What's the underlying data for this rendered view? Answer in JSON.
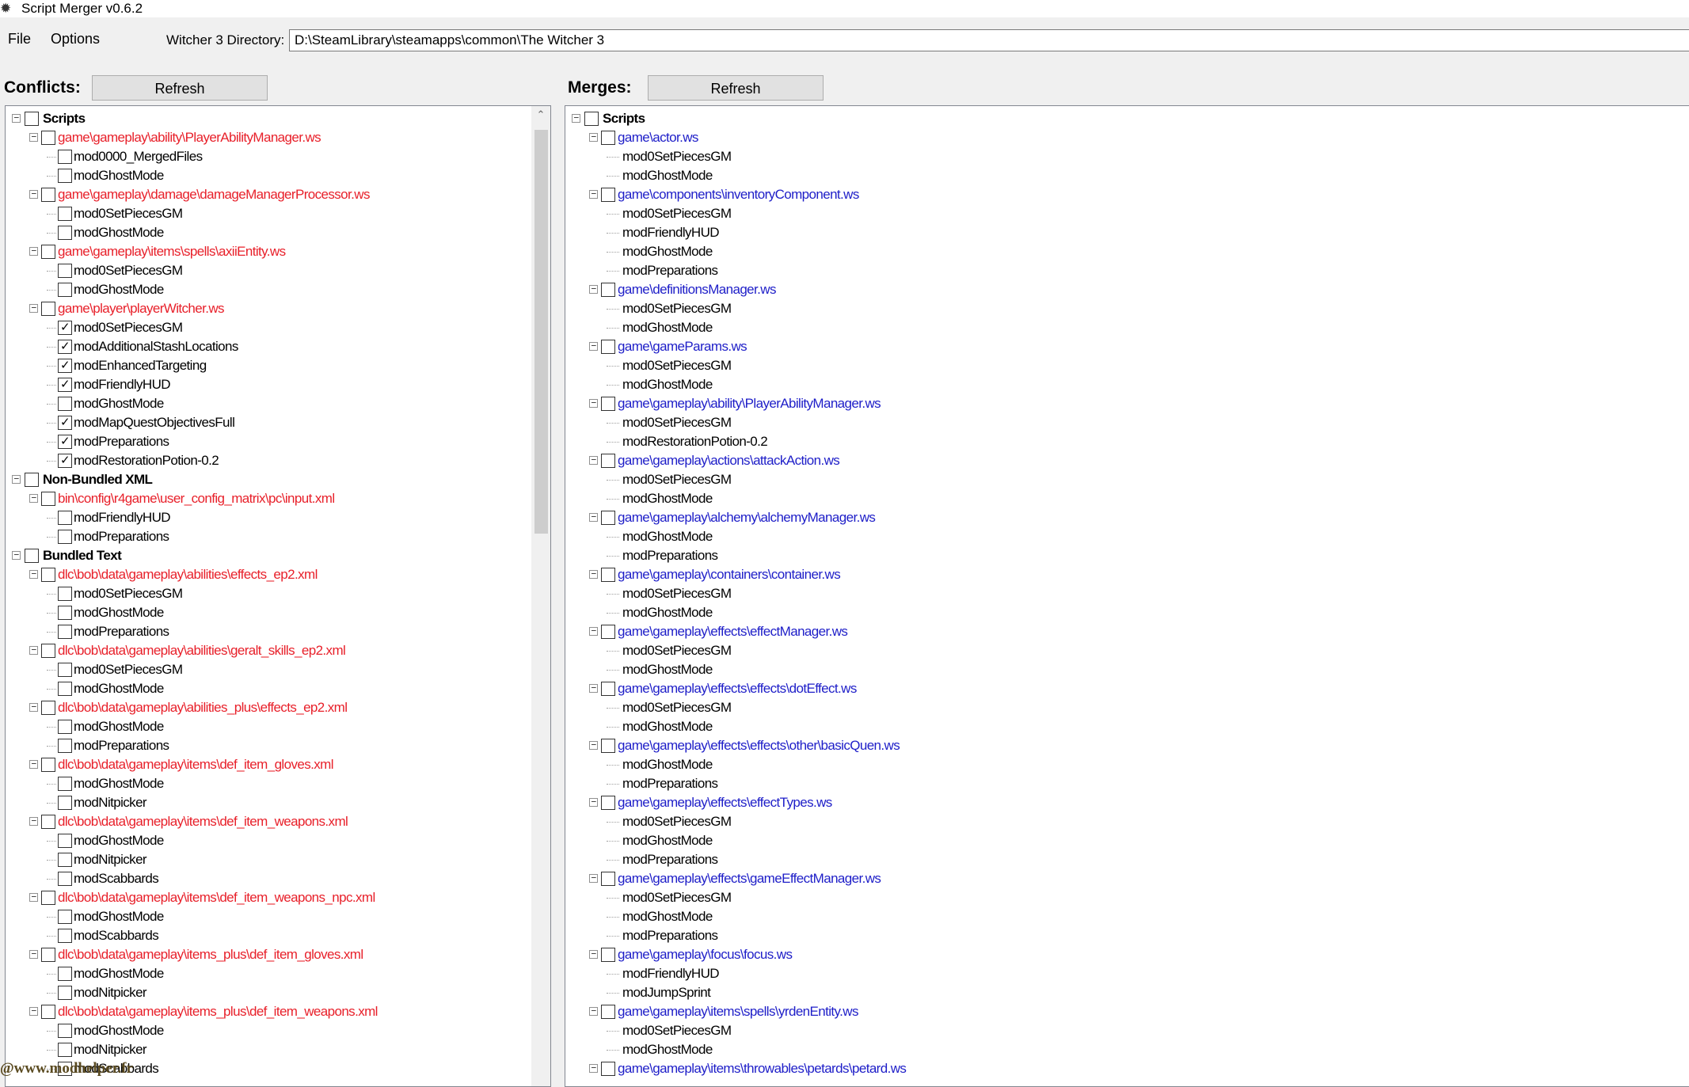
{
  "window": {
    "title": "Script Merger v0.6.2",
    "icon": "witcher-wolf-icon"
  },
  "menu": {
    "file": "File",
    "options": "Options"
  },
  "directory": {
    "label": "Witcher 3 Directory:",
    "value": "D:\\SteamLibrary\\steamapps\\common\\The Witcher 3"
  },
  "conflicts": {
    "label": "Conflicts:",
    "refresh": "Refresh",
    "rows": [
      {
        "level": 0,
        "text": "Scripts",
        "checked": false
      },
      {
        "level": 1,
        "text": "game\\gameplay\\ability\\PlayerAbilityManager.ws",
        "checked": false
      },
      {
        "level": 2,
        "text": "mod0000_MergedFiles",
        "checked": false
      },
      {
        "level": 2,
        "text": "modGhostMode",
        "checked": false
      },
      {
        "level": 1,
        "text": "game\\gameplay\\damage\\damageManagerProcessor.ws",
        "checked": false
      },
      {
        "level": 2,
        "text": "mod0SetPiecesGM",
        "checked": false
      },
      {
        "level": 2,
        "text": "modGhostMode",
        "checked": false
      },
      {
        "level": 1,
        "text": "game\\gameplay\\items\\spells\\axiiEntity.ws",
        "checked": false
      },
      {
        "level": 2,
        "text": "mod0SetPiecesGM",
        "checked": false
      },
      {
        "level": 2,
        "text": "modGhostMode",
        "checked": false
      },
      {
        "level": 1,
        "text": "game\\player\\playerWitcher.ws",
        "checked": false
      },
      {
        "level": 2,
        "text": "mod0SetPiecesGM",
        "checked": true
      },
      {
        "level": 2,
        "text": "modAdditionalStashLocations",
        "checked": true
      },
      {
        "level": 2,
        "text": "modEnhancedTargeting",
        "checked": true
      },
      {
        "level": 2,
        "text": "modFriendlyHUD",
        "checked": true
      },
      {
        "level": 2,
        "text": "modGhostMode",
        "checked": false
      },
      {
        "level": 2,
        "text": "modMapQuestObjectivesFull",
        "checked": true
      },
      {
        "level": 2,
        "text": "modPreparations",
        "checked": true
      },
      {
        "level": 2,
        "text": "modRestorationPotion-0.2",
        "checked": true
      },
      {
        "level": 0,
        "text": "Non-Bundled XML",
        "checked": false
      },
      {
        "level": 1,
        "text": "bin\\config\\r4game\\user_config_matrix\\pc\\input.xml",
        "checked": false
      },
      {
        "level": 2,
        "text": "modFriendlyHUD",
        "checked": false
      },
      {
        "level": 2,
        "text": "modPreparations",
        "checked": false
      },
      {
        "level": 0,
        "text": "Bundled Text",
        "checked": false
      },
      {
        "level": 1,
        "text": "dlc\\bob\\data\\gameplay\\abilities\\effects_ep2.xml",
        "checked": false
      },
      {
        "level": 2,
        "text": "mod0SetPiecesGM",
        "checked": false
      },
      {
        "level": 2,
        "text": "modGhostMode",
        "checked": false
      },
      {
        "level": 2,
        "text": "modPreparations",
        "checked": false
      },
      {
        "level": 1,
        "text": "dlc\\bob\\data\\gameplay\\abilities\\geralt_skills_ep2.xml",
        "checked": false
      },
      {
        "level": 2,
        "text": "mod0SetPiecesGM",
        "checked": false
      },
      {
        "level": 2,
        "text": "modGhostMode",
        "checked": false
      },
      {
        "level": 1,
        "text": "dlc\\bob\\data\\gameplay\\abilities_plus\\effects_ep2.xml",
        "checked": false
      },
      {
        "level": 2,
        "text": "modGhostMode",
        "checked": false
      },
      {
        "level": 2,
        "text": "modPreparations",
        "checked": false
      },
      {
        "level": 1,
        "text": "dlc\\bob\\data\\gameplay\\items\\def_item_gloves.xml",
        "checked": false
      },
      {
        "level": 2,
        "text": "modGhostMode",
        "checked": false
      },
      {
        "level": 2,
        "text": "modNitpicker",
        "checked": false
      },
      {
        "level": 1,
        "text": "dlc\\bob\\data\\gameplay\\items\\def_item_weapons.xml",
        "checked": false
      },
      {
        "level": 2,
        "text": "modGhostMode",
        "checked": false
      },
      {
        "level": 2,
        "text": "modNitpicker",
        "checked": false
      },
      {
        "level": 2,
        "text": "modScabbards",
        "checked": false
      },
      {
        "level": 1,
        "text": "dlc\\bob\\data\\gameplay\\items\\def_item_weapons_npc.xml",
        "checked": false
      },
      {
        "level": 2,
        "text": "modGhostMode",
        "checked": false
      },
      {
        "level": 2,
        "text": "modScabbards",
        "checked": false
      },
      {
        "level": 1,
        "text": "dlc\\bob\\data\\gameplay\\items_plus\\def_item_gloves.xml",
        "checked": false
      },
      {
        "level": 2,
        "text": "modGhostMode",
        "checked": false
      },
      {
        "level": 2,
        "text": "modNitpicker",
        "checked": false
      },
      {
        "level": 1,
        "text": "dlc\\bob\\data\\gameplay\\items_plus\\def_item_weapons.xml",
        "checked": false
      },
      {
        "level": 2,
        "text": "modGhostMode",
        "checked": false
      },
      {
        "level": 2,
        "text": "modNitpicker",
        "checked": false
      },
      {
        "level": 2,
        "text": "modScabbards",
        "checked": false
      }
    ]
  },
  "merges": {
    "label": "Merges:",
    "refresh": "Refresh",
    "rows": [
      {
        "level": 0,
        "text": "Scripts",
        "checked": false
      },
      {
        "level": 1,
        "text": "game\\actor.ws",
        "checked": false
      },
      {
        "level": 2,
        "text": "mod0SetPiecesGM"
      },
      {
        "level": 2,
        "text": "modGhostMode"
      },
      {
        "level": 1,
        "text": "game\\components\\inventoryComponent.ws",
        "checked": false
      },
      {
        "level": 2,
        "text": "mod0SetPiecesGM"
      },
      {
        "level": 2,
        "text": "modFriendlyHUD"
      },
      {
        "level": 2,
        "text": "modGhostMode"
      },
      {
        "level": 2,
        "text": "modPreparations"
      },
      {
        "level": 1,
        "text": "game\\definitionsManager.ws",
        "checked": false
      },
      {
        "level": 2,
        "text": "mod0SetPiecesGM"
      },
      {
        "level": 2,
        "text": "modGhostMode"
      },
      {
        "level": 1,
        "text": "game\\gameParams.ws",
        "checked": false
      },
      {
        "level": 2,
        "text": "mod0SetPiecesGM"
      },
      {
        "level": 2,
        "text": "modGhostMode"
      },
      {
        "level": 1,
        "text": "game\\gameplay\\ability\\PlayerAbilityManager.ws",
        "checked": false
      },
      {
        "level": 2,
        "text": "mod0SetPiecesGM"
      },
      {
        "level": 2,
        "text": "modRestorationPotion-0.2"
      },
      {
        "level": 1,
        "text": "game\\gameplay\\actions\\attackAction.ws",
        "checked": false
      },
      {
        "level": 2,
        "text": "mod0SetPiecesGM"
      },
      {
        "level": 2,
        "text": "modGhostMode"
      },
      {
        "level": 1,
        "text": "game\\gameplay\\alchemy\\alchemyManager.ws",
        "checked": false
      },
      {
        "level": 2,
        "text": "modGhostMode"
      },
      {
        "level": 2,
        "text": "modPreparations"
      },
      {
        "level": 1,
        "text": "game\\gameplay\\containers\\container.ws",
        "checked": false
      },
      {
        "level": 2,
        "text": "mod0SetPiecesGM"
      },
      {
        "level": 2,
        "text": "modGhostMode"
      },
      {
        "level": 1,
        "text": "game\\gameplay\\effects\\effectManager.ws",
        "checked": false
      },
      {
        "level": 2,
        "text": "mod0SetPiecesGM"
      },
      {
        "level": 2,
        "text": "modGhostMode"
      },
      {
        "level": 1,
        "text": "game\\gameplay\\effects\\effects\\dotEffect.ws",
        "checked": false
      },
      {
        "level": 2,
        "text": "mod0SetPiecesGM"
      },
      {
        "level": 2,
        "text": "modGhostMode"
      },
      {
        "level": 1,
        "text": "game\\gameplay\\effects\\effects\\other\\basicQuen.ws",
        "checked": false
      },
      {
        "level": 2,
        "text": "modGhostMode"
      },
      {
        "level": 2,
        "text": "modPreparations"
      },
      {
        "level": 1,
        "text": "game\\gameplay\\effects\\effectTypes.ws",
        "checked": false
      },
      {
        "level": 2,
        "text": "mod0SetPiecesGM"
      },
      {
        "level": 2,
        "text": "modGhostMode"
      },
      {
        "level": 2,
        "text": "modPreparations"
      },
      {
        "level": 1,
        "text": "game\\gameplay\\effects\\gameEffectManager.ws",
        "checked": false
      },
      {
        "level": 2,
        "text": "mod0SetPiecesGM"
      },
      {
        "level": 2,
        "text": "modGhostMode"
      },
      {
        "level": 2,
        "text": "modPreparations"
      },
      {
        "level": 1,
        "text": "game\\gameplay\\focus\\focus.ws",
        "checked": false
      },
      {
        "level": 2,
        "text": "modFriendlyHUD"
      },
      {
        "level": 2,
        "text": "modJumpSprint"
      },
      {
        "level": 1,
        "text": "game\\gameplay\\items\\spells\\yrdenEntity.ws",
        "checked": false
      },
      {
        "level": 2,
        "text": "mod0SetPiecesGM"
      },
      {
        "level": 2,
        "text": "modGhostMode"
      },
      {
        "level": 1,
        "text": "game\\gameplay\\items\\throwables\\petards\\petard.ws",
        "checked": false
      }
    ]
  },
  "watermark": "@www.modhelper.fr"
}
